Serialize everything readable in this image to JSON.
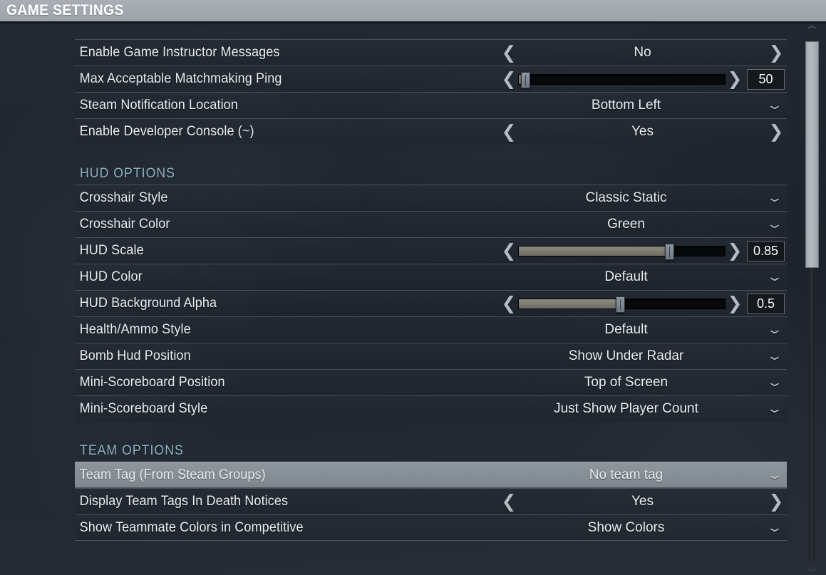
{
  "window": {
    "title": "GAME SETTINGS"
  },
  "icons": {
    "chevron_left": "❮",
    "chevron_right": "❯",
    "chevron_down": "⌄",
    "chevron_up": "⌃"
  },
  "scrollbar": {
    "up_arrow": "⌃",
    "down_arrow": "⌄",
    "thumb_position_percent": 0,
    "thumb_size_percent": 42
  },
  "settings": [
    {
      "type": "toggle",
      "label": "Enable Game Instructor Messages",
      "value": "No"
    },
    {
      "type": "slider",
      "label": "Max Acceptable Matchmaking Ping",
      "value": "50",
      "fill_percent": 3,
      "knob_percent": 3
    },
    {
      "type": "dropdown",
      "label": "Steam Notification Location",
      "value": "Bottom Left"
    },
    {
      "type": "toggle",
      "label": "Enable Developer Console (~)",
      "value": "Yes"
    },
    {
      "type": "section",
      "label": "HUD OPTIONS"
    },
    {
      "type": "dropdown",
      "label": "Crosshair Style",
      "value": "Classic Static"
    },
    {
      "type": "dropdown",
      "label": "Crosshair Color",
      "value": "Green"
    },
    {
      "type": "slider",
      "label": "HUD Scale",
      "value": "0.85",
      "fill_percent": 73,
      "knob_percent": 73
    },
    {
      "type": "dropdown",
      "label": "HUD Color",
      "value": "Default"
    },
    {
      "type": "slider",
      "label": "HUD Background Alpha",
      "value": "0.5",
      "fill_percent": 49,
      "knob_percent": 49
    },
    {
      "type": "dropdown",
      "label": "Health/Ammo Style",
      "value": "Default"
    },
    {
      "type": "dropdown",
      "label": "Bomb Hud Position",
      "value": "Show Under Radar"
    },
    {
      "type": "dropdown",
      "label": "Mini-Scoreboard Position",
      "value": "Top of Screen"
    },
    {
      "type": "dropdown",
      "label": "Mini-Scoreboard Style",
      "value": "Just Show Player Count"
    },
    {
      "type": "section",
      "label": "TEAM OPTIONS"
    },
    {
      "type": "dropdown",
      "label": "Team Tag (From Steam Groups)",
      "value": "No team tag",
      "selected": true
    },
    {
      "type": "toggle",
      "label": "Display Team Tags In Death Notices",
      "value": "Yes"
    },
    {
      "type": "dropdown",
      "label": "Show Teammate Colors in Competitive",
      "value": "Show Colors"
    }
  ],
  "colors": {
    "titlebar": "#a3a9b0",
    "section_header": "#8fb3c4",
    "row_text": "#e9edf1",
    "selected_row": "#868e96",
    "background": "#20262f"
  }
}
